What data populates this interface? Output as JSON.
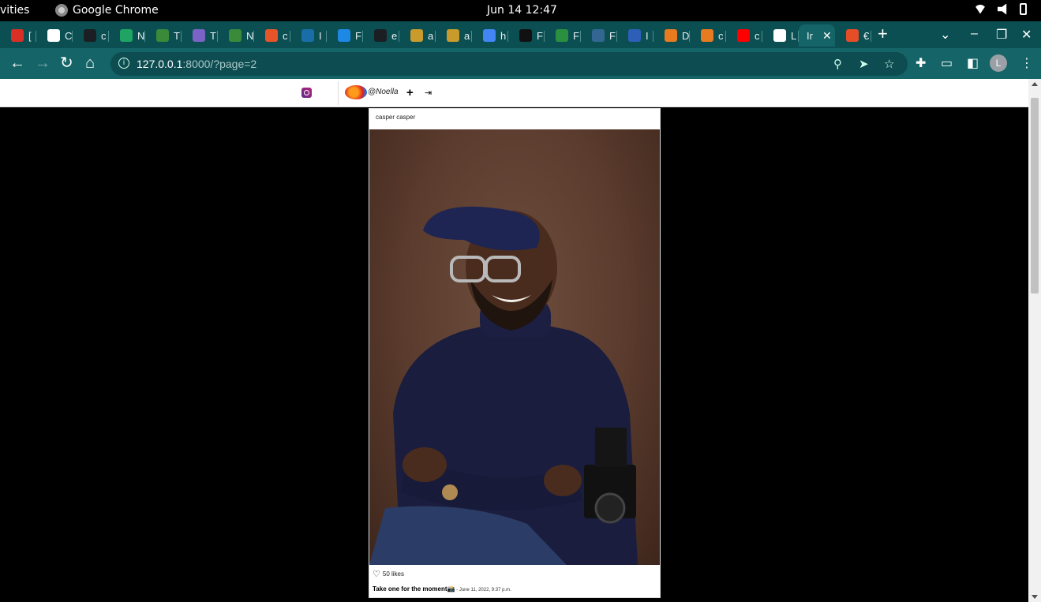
{
  "os_bar": {
    "activities": "vities",
    "app_name": "Google Chrome",
    "clock": "Jun 14  12:47"
  },
  "tabs": [
    {
      "icon": "gmail-icon",
      "label": "[",
      "color": "#d93025"
    },
    {
      "icon": "globe-icon",
      "label": "C",
      "color": "#ffffff"
    },
    {
      "icon": "github-icon",
      "label": "c",
      "color": "#1b1f23"
    },
    {
      "icon": "drive-icon",
      "label": "N",
      "color": "#1fa463"
    },
    {
      "icon": "palm-icon",
      "label": "T",
      "color": "#3a8a3a"
    },
    {
      "icon": "heroku-icon",
      "label": "T",
      "color": "#7b63c6"
    },
    {
      "icon": "palm-icon",
      "label": "N",
      "color": "#3a8a3a"
    },
    {
      "icon": "ask-icon",
      "label": "c",
      "color": "#e8542a"
    },
    {
      "icon": "chart-icon",
      "label": "I",
      "color": "#1a6ea8"
    },
    {
      "icon": "refresh-icon",
      "label": "F",
      "color": "#1e88e5"
    },
    {
      "icon": "github-icon",
      "label": "e",
      "color": "#1b1f23"
    },
    {
      "icon": "trophy-icon",
      "label": "a",
      "color": "#c89b2c"
    },
    {
      "icon": "trophy-icon",
      "label": "a",
      "color": "#c89b2c"
    },
    {
      "icon": "google-icon",
      "label": "h",
      "color": "#4285f4"
    },
    {
      "icon": "dev-icon",
      "label": "F",
      "color": "#111111"
    },
    {
      "icon": "sensu-icon",
      "label": "F",
      "color": "#2a8f3e"
    },
    {
      "icon": "postgres-icon",
      "label": "F",
      "color": "#336791"
    },
    {
      "icon": "site-icon",
      "label": "I",
      "color": "#2e5fb8"
    },
    {
      "icon": "stack-icon",
      "label": "D",
      "color": "#e87a20"
    },
    {
      "icon": "stack-icon",
      "label": "c",
      "color": "#e87a20"
    },
    {
      "icon": "youtube-icon",
      "label": "c",
      "color": "#ff0000"
    },
    {
      "icon": "globe-icon",
      "label": "L",
      "color": "#ffffff"
    },
    {
      "icon": "instagram-icon",
      "label": "Ir",
      "color": "#146468",
      "active": true
    },
    {
      "icon": "html5-icon",
      "label": "€",
      "color": "#e44d26"
    }
  ],
  "toolbar": {
    "url_host": "127.0.0.1",
    "url_rest": ":8000/?page=2",
    "profile_initial": "L"
  },
  "navbar": {
    "username": "@Noella",
    "add_label": "+",
    "logout_label": "⇥"
  },
  "post": {
    "author": "casper casper",
    "likes_text": "50 likes",
    "caption_bold": "Take one for the moment",
    "caption_emoji": "📸",
    "caption_meta": " - June 11, 2022, 9:37 p.m."
  }
}
